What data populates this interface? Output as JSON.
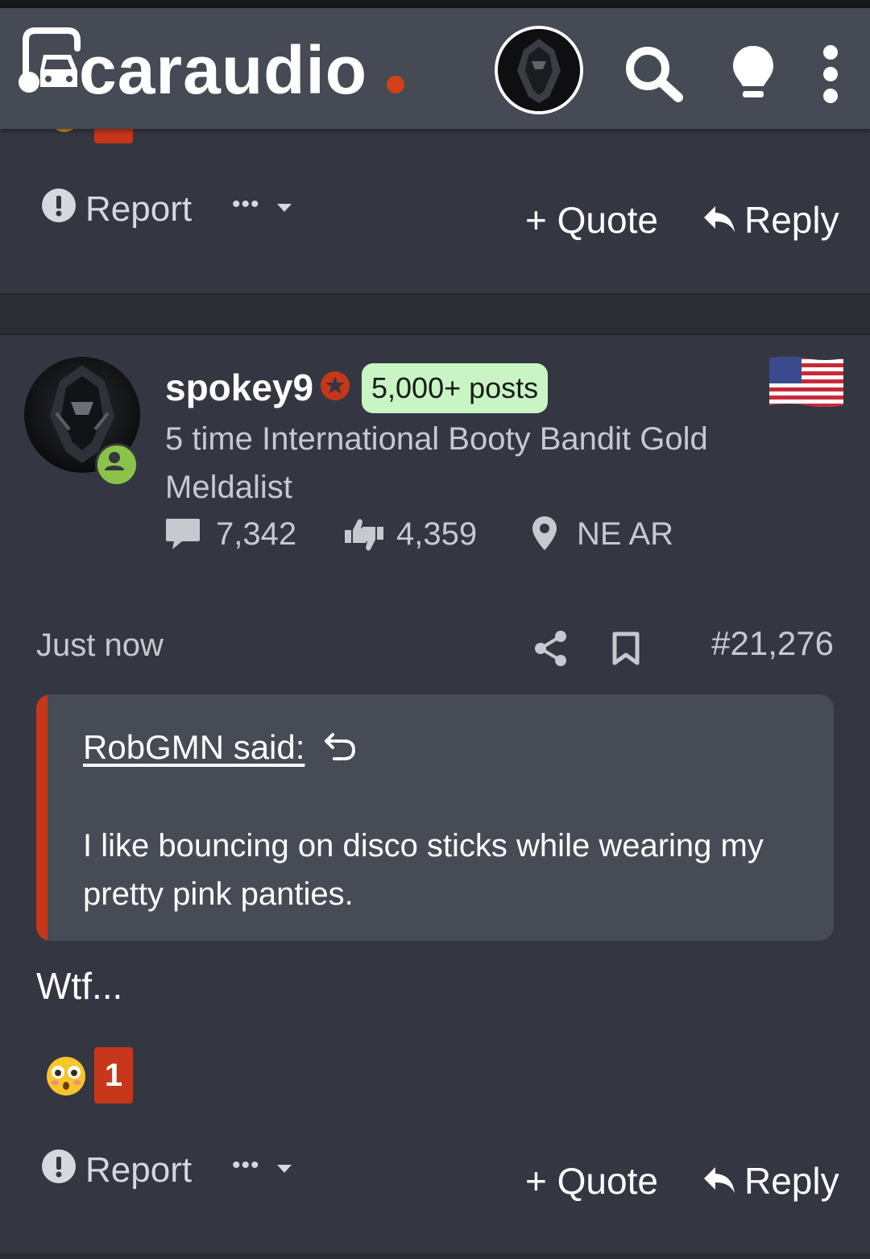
{
  "header": {
    "logo_text": "caraudio",
    "icons": [
      "avatar",
      "search-icon",
      "lightbulb-icon",
      "more-vertical-icon"
    ]
  },
  "prev_post_actions": {
    "report_label": "Report",
    "more_label": "•••",
    "quote_label": "+ Quote",
    "reply_label": "Reply"
  },
  "post": {
    "username": "spokey9",
    "posts_badge": "5,000+ posts",
    "user_title": "5 time International Booty Bandit Gold Meldalist",
    "stats": {
      "messages": "7,342",
      "reactions": "4,359",
      "location": "NE AR"
    },
    "time": "Just now",
    "post_number": "#21,276",
    "quote": {
      "author": "RobGMN said:",
      "text": "I like bouncing on disco sticks while wearing my pretty pink panties."
    },
    "body": "Wtf...",
    "reaction": {
      "emoji": "flushed-face",
      "count": "1"
    },
    "actions": {
      "report_label": "Report",
      "more_label": "•••",
      "quote_label": "+ Quote",
      "reply_label": "Reply"
    }
  },
  "colors": {
    "accent": "#c8361a",
    "header_bg": "#464a55",
    "page_bg": "#343741",
    "posts_badge_bg": "#c9f5c4",
    "online_green": "#8bc34a"
  }
}
